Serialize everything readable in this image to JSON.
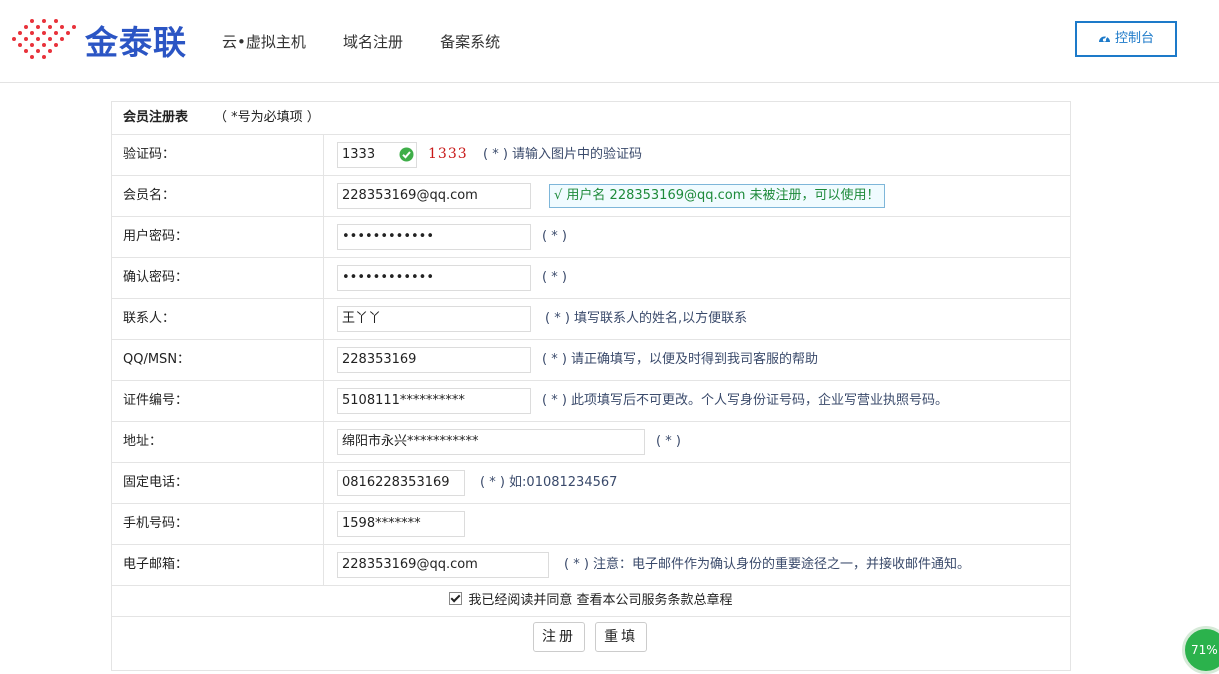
{
  "brand": {
    "logo_text": "金泰联"
  },
  "nav": {
    "items": [
      "云•虚拟主机",
      "域名注册",
      "备案系统"
    ]
  },
  "console_button": {
    "label": "控制台"
  },
  "form": {
    "title": "会员注册表",
    "note": "（ *号为必填项 ）",
    "rows": [
      {
        "label": "验证码：",
        "value": "1333",
        "captcha": "1333",
        "hint": "( * ) 请输入图片中的验证码"
      },
      {
        "label": "会员名：",
        "value": "228353169@qq.com",
        "status": "√ 用户名 228353169@qq.com 未被注册，可以使用！"
      },
      {
        "label": "用户密码：",
        "value": "••••••••••••",
        "hint": "( * )"
      },
      {
        "label": "确认密码：",
        "value": "••••••••••••",
        "hint": "( * )"
      },
      {
        "label": "联系人：",
        "value": "王丫丫",
        "hint": "( * ) 填写联系人的姓名,以方便联系"
      },
      {
        "label": "QQ/MSN：",
        "value": "228353169",
        "hint": "( * ) 请正确填写，以便及时得到我司客服的帮助"
      },
      {
        "label": "证件编号：",
        "value": "5108111**********",
        "hint": "( * ) 此项填写后不可更改。个人写身份证号码，企业写营业执照号码。"
      },
      {
        "label": "地址：",
        "value": "绵阳市永兴***********",
        "hint": "( * )"
      },
      {
        "label": "固定电话：",
        "value": "0816228353169",
        "hint": "( * ) 如:01081234567"
      },
      {
        "label": "手机号码：",
        "value": "1598*******",
        "hint": ""
      },
      {
        "label": "电子邮箱：",
        "value": "228353169@qq.com",
        "hint": "( * ) 注意：电子邮件作为确认身份的重要途径之一，并接收邮件通知。"
      }
    ],
    "agree": "我已经阅读并同意  查看本公司服务条款总章程",
    "submit_label": "注册",
    "reset_label": "重填"
  },
  "progress_badge": {
    "text": "71%"
  },
  "colors": {
    "brand_blue": "#2b55c4",
    "console_blue": "#1d7ac9",
    "ok_green": "#1d8a3a",
    "captcha_red": "#c81818"
  }
}
